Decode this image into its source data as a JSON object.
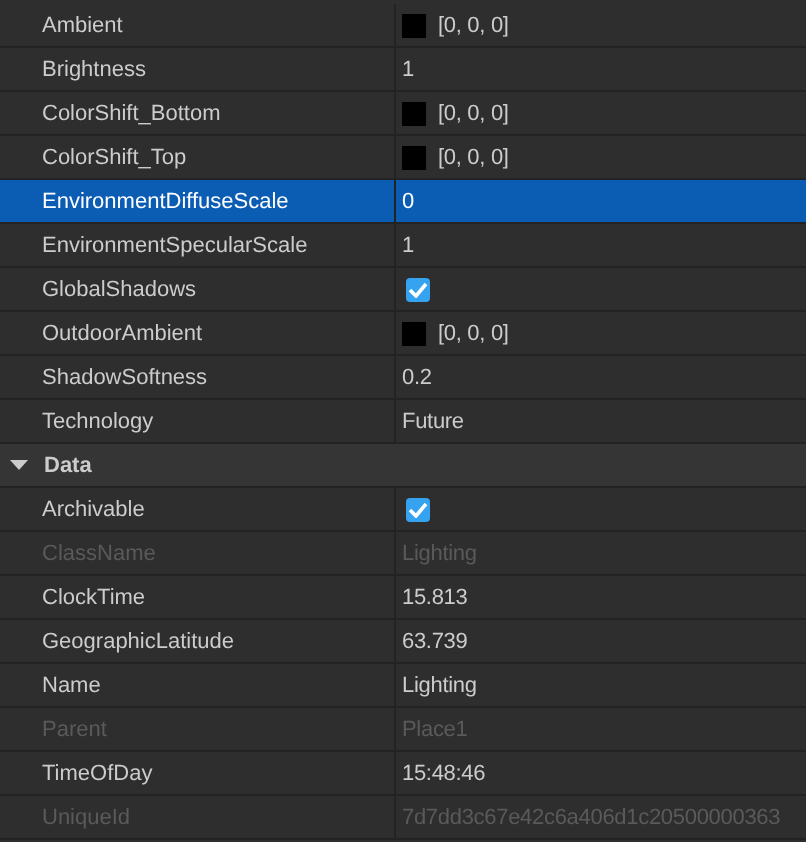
{
  "sections": [
    {
      "rows": [
        {
          "kind": "color",
          "name": "Ambient",
          "value": "[0, 0, 0]",
          "color": "#000000",
          "selected": false,
          "disabled": false
        },
        {
          "kind": "text",
          "name": "Brightness",
          "value": "1",
          "selected": false,
          "disabled": false
        },
        {
          "kind": "color",
          "name": "ColorShift_Bottom",
          "value": "[0, 0, 0]",
          "color": "#000000",
          "selected": false,
          "disabled": false
        },
        {
          "kind": "color",
          "name": "ColorShift_Top",
          "value": "[0, 0, 0]",
          "color": "#000000",
          "selected": false,
          "disabled": false
        },
        {
          "kind": "text",
          "name": "EnvironmentDiffuseScale",
          "value": "0",
          "selected": true,
          "disabled": false
        },
        {
          "kind": "text",
          "name": "EnvironmentSpecularScale",
          "value": "1",
          "selected": false,
          "disabled": false
        },
        {
          "kind": "checkbox",
          "name": "GlobalShadows",
          "checked": true,
          "selected": false,
          "disabled": false
        },
        {
          "kind": "color",
          "name": "OutdoorAmbient",
          "value": "[0, 0, 0]",
          "color": "#000000",
          "selected": false,
          "disabled": false
        },
        {
          "kind": "text",
          "name": "ShadowSoftness",
          "value": "0.2",
          "selected": false,
          "disabled": false
        },
        {
          "kind": "text",
          "name": "Technology",
          "value": "Future",
          "selected": false,
          "disabled": false
        }
      ]
    },
    {
      "title": "Data",
      "expanded": true,
      "rows": [
        {
          "kind": "checkbox",
          "name": "Archivable",
          "checked": true,
          "selected": false,
          "disabled": false
        },
        {
          "kind": "text",
          "name": "ClassName",
          "value": "Lighting",
          "selected": false,
          "disabled": true
        },
        {
          "kind": "text",
          "name": "ClockTime",
          "value": "15.813",
          "selected": false,
          "disabled": false
        },
        {
          "kind": "text",
          "name": "GeographicLatitude",
          "value": "63.739",
          "selected": false,
          "disabled": false
        },
        {
          "kind": "text",
          "name": "Name",
          "value": "Lighting",
          "selected": false,
          "disabled": false
        },
        {
          "kind": "text",
          "name": "Parent",
          "value": "Place1",
          "selected": false,
          "disabled": true
        },
        {
          "kind": "text",
          "name": "TimeOfDay",
          "value": "15:48:46",
          "selected": false,
          "disabled": false
        },
        {
          "kind": "text",
          "name": "UniqueId",
          "value": "7d7dd3c67e42c6a406d1c20500000363",
          "selected": false,
          "disabled": true
        }
      ]
    }
  ]
}
